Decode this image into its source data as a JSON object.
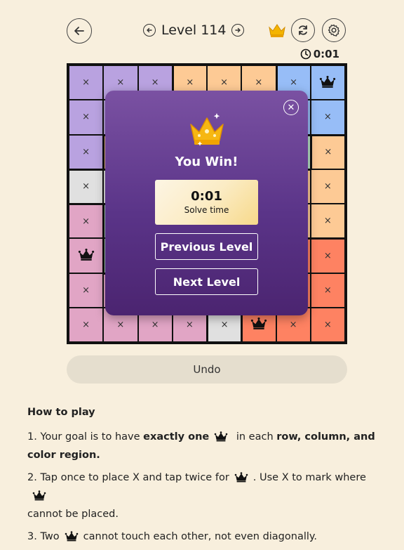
{
  "header": {
    "level_title": "Level 114",
    "timer": "0:01",
    "icons": [
      "back-arrow-icon",
      "prev-level-icon",
      "next-level-icon",
      "crown-icon",
      "restart-icon",
      "gear-icon",
      "clock-icon"
    ]
  },
  "board": {
    "size": 8,
    "colors": {
      "purple": "#b9a2e0",
      "orange": "#fdca95",
      "blue": "#97bdf7",
      "pink": "#e1a5c5",
      "red": "#fe8262",
      "gray": "#e0e0e0",
      "green": "#b7e1c6"
    },
    "regions": [
      [
        "purple",
        "purple",
        "purple",
        "orange",
        "orange",
        "orange",
        "blue",
        "blue"
      ],
      [
        "purple",
        "purple",
        "purple",
        "orange",
        "orange",
        "orange",
        "blue",
        "blue"
      ],
      [
        "purple",
        "orange",
        "orange",
        "orange",
        "orange",
        "orange",
        "green",
        "orange"
      ],
      [
        "gray",
        "gray",
        "gray",
        "gray",
        "gray",
        "orange",
        "orange",
        "orange"
      ],
      [
        "pink",
        "green",
        "gray",
        "gray",
        "gray",
        "orange",
        "orange",
        "orange"
      ],
      [
        "pink",
        "green",
        "gray",
        "gray",
        "gray",
        "orange",
        "red",
        "red"
      ],
      [
        "pink",
        "pink",
        "pink",
        "pink",
        "gray",
        "red",
        "red",
        "red"
      ],
      [
        "pink",
        "pink",
        "pink",
        "pink",
        "gray",
        "red",
        "red",
        "red"
      ]
    ],
    "marks": [
      [
        "x",
        "x",
        "x",
        "x",
        "x",
        "x",
        "x",
        "Q"
      ],
      [
        "x",
        "x",
        "x",
        "x",
        "x",
        "x",
        "x",
        "x"
      ],
      [
        "x",
        "x",
        "x",
        "x",
        "x",
        "x",
        "x",
        "x"
      ],
      [
        "x",
        "x",
        "x",
        "x",
        "x",
        "x",
        "x",
        "x"
      ],
      [
        "x",
        "x",
        "x",
        "x",
        "x",
        "x",
        "x",
        "x"
      ],
      [
        "Q",
        "x",
        "x",
        "x",
        "x",
        "x",
        "x",
        "x"
      ],
      [
        "x",
        "x",
        "x",
        "x",
        "x",
        "x",
        "x",
        "x"
      ],
      [
        "x",
        "x",
        "x",
        "x",
        "x",
        "Q",
        "x",
        "x"
      ]
    ]
  },
  "modal": {
    "title": "You Win!",
    "time_value": "0:01",
    "time_label": "Solve time",
    "prev_label": "Previous Level",
    "next_label": "Next Level"
  },
  "undo_label": "Undo",
  "howto": {
    "title": "How to play",
    "r1_a": "1. Your goal is to have ",
    "r1_b": "exactly one",
    "r1_c": " in each ",
    "r1_d": "row, column, and color region.",
    "r2_a": "2. Tap once to place X and tap twice for",
    "r2_b": ". Use X to mark where",
    "r2_c": "cannot be placed.",
    "r3_a": "3. Two",
    "r3_b": "cannot touch each other, not even diagonally."
  }
}
